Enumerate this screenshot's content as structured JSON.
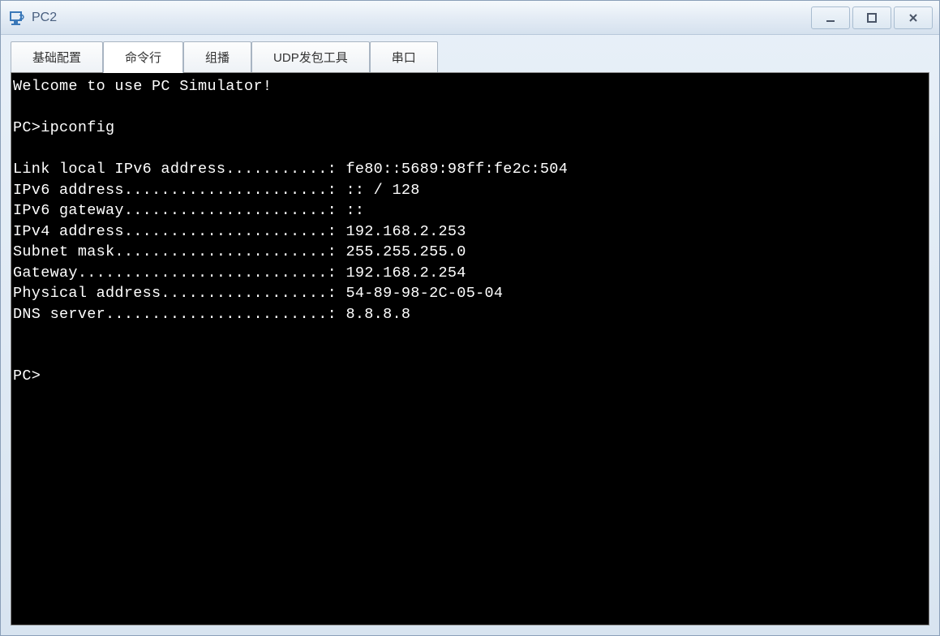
{
  "window": {
    "title": "PC2"
  },
  "tabs": [
    {
      "label": "基础配置",
      "active": false
    },
    {
      "label": "命令行",
      "active": true
    },
    {
      "label": "组播",
      "active": false
    },
    {
      "label": "UDP发包工具",
      "active": false
    },
    {
      "label": "串口",
      "active": false
    }
  ],
  "terminal": {
    "welcome": "Welcome to use PC Simulator!",
    "prompt1": "PC>ipconfig",
    "line_ipv6_link": "Link local IPv6 address...........: fe80::5689:98ff:fe2c:504",
    "line_ipv6_addr": "IPv6 address......................: :: / 128",
    "line_ipv6_gw": "IPv6 gateway......................: ::",
    "line_ipv4_addr": "IPv4 address......................: 192.168.2.253",
    "line_subnet": "Subnet mask.......................: 255.255.255.0",
    "line_gateway": "Gateway...........................: 192.168.2.254",
    "line_mac": "Physical address..................: 54-89-98-2C-05-04",
    "line_dns": "DNS server........................: 8.8.8.8",
    "prompt2": "PC>"
  },
  "ipconfig_data": {
    "link_local_ipv6_address": "fe80::5689:98ff:fe2c:504",
    "ipv6_address": ":: / 128",
    "ipv6_gateway": "::",
    "ipv4_address": "192.168.2.253",
    "subnet_mask": "255.255.255.0",
    "gateway": "192.168.2.254",
    "physical_address": "54-89-98-2C-05-04",
    "dns_server": "8.8.8.8"
  }
}
